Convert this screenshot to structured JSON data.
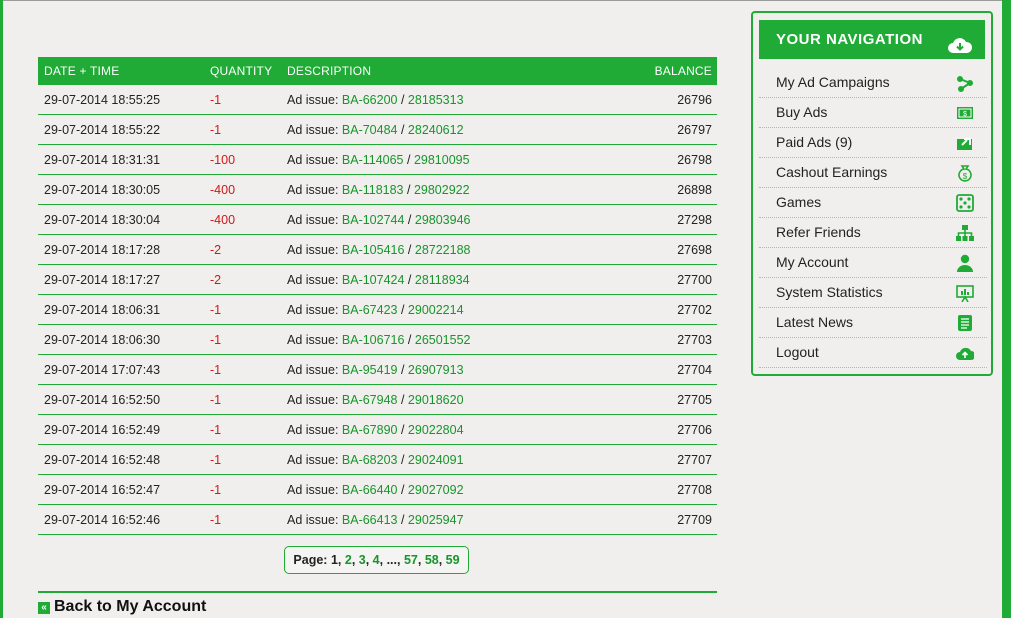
{
  "table": {
    "headers": {
      "datetime": "DATE + TIME",
      "quantity": "QUANTITY",
      "description": "DESCRIPTION",
      "balance": "BALANCE"
    },
    "desc_prefix": "Ad issue: ",
    "separator": " / ",
    "rows": [
      {
        "datetime": "29-07-2014 18:55:25",
        "quantity": "-1",
        "ad": "BA-66200",
        "ref": "28185313",
        "balance": "26796"
      },
      {
        "datetime": "29-07-2014 18:55:22",
        "quantity": "-1",
        "ad": "BA-70484",
        "ref": "28240612",
        "balance": "26797"
      },
      {
        "datetime": "29-07-2014 18:31:31",
        "quantity": "-100",
        "ad": "BA-114065",
        "ref": "29810095",
        "balance": "26798"
      },
      {
        "datetime": "29-07-2014 18:30:05",
        "quantity": "-400",
        "ad": "BA-118183",
        "ref": "29802922",
        "balance": "26898"
      },
      {
        "datetime": "29-07-2014 18:30:04",
        "quantity": "-400",
        "ad": "BA-102744",
        "ref": "29803946",
        "balance": "27298"
      },
      {
        "datetime": "29-07-2014 18:17:28",
        "quantity": "-2",
        "ad": "BA-105416",
        "ref": "28722188",
        "balance": "27698"
      },
      {
        "datetime": "29-07-2014 18:17:27",
        "quantity": "-2",
        "ad": "BA-107424",
        "ref": "28118934",
        "balance": "27700"
      },
      {
        "datetime": "29-07-2014 18:06:31",
        "quantity": "-1",
        "ad": "BA-67423",
        "ref": "29002214",
        "balance": "27702"
      },
      {
        "datetime": "29-07-2014 18:06:30",
        "quantity": "-1",
        "ad": "BA-106716",
        "ref": "26501552",
        "balance": "27703"
      },
      {
        "datetime": "29-07-2014 17:07:43",
        "quantity": "-1",
        "ad": "BA-95419",
        "ref": "26907913",
        "balance": "27704"
      },
      {
        "datetime": "29-07-2014 16:52:50",
        "quantity": "-1",
        "ad": "BA-67948",
        "ref": "29018620",
        "balance": "27705"
      },
      {
        "datetime": "29-07-2014 16:52:49",
        "quantity": "-1",
        "ad": "BA-67890",
        "ref": "29022804",
        "balance": "27706"
      },
      {
        "datetime": "29-07-2014 16:52:48",
        "quantity": "-1",
        "ad": "BA-68203",
        "ref": "29024091",
        "balance": "27707"
      },
      {
        "datetime": "29-07-2014 16:52:47",
        "quantity": "-1",
        "ad": "BA-66440",
        "ref": "29027092",
        "balance": "27708"
      },
      {
        "datetime": "29-07-2014 16:52:46",
        "quantity": "-1",
        "ad": "BA-66413",
        "ref": "29025947",
        "balance": "27709"
      }
    ]
  },
  "pager": {
    "label": "Page:",
    "current": "1",
    "pages_before": [
      "2",
      "3",
      "4"
    ],
    "ellipsis": "...",
    "pages_after": [
      "57",
      "58",
      "59"
    ]
  },
  "back_link": "Back to My Account",
  "nav": {
    "title": "YOUR NAVIGATION",
    "items": [
      {
        "label": "My Ad Campaigns",
        "icon": "share-icon"
      },
      {
        "label": "Buy Ads",
        "icon": "banknote-icon"
      },
      {
        "label": "Paid Ads (9)",
        "icon": "paid-ads-icon"
      },
      {
        "label": "Cashout Earnings",
        "icon": "money-bag-icon"
      },
      {
        "label": "Games",
        "icon": "dice-icon"
      },
      {
        "label": "Refer Friends",
        "icon": "sitemap-icon"
      },
      {
        "label": "My Account",
        "icon": "user-icon"
      },
      {
        "label": "System Statistics",
        "icon": "presentation-icon"
      },
      {
        "label": "Latest News",
        "icon": "news-icon"
      },
      {
        "label": "Logout",
        "icon": "cloud-icon"
      }
    ]
  },
  "colors": {
    "accent": "#1fab35",
    "link": "#17952b",
    "negative": "#d01818",
    "background": "#f0efed"
  }
}
